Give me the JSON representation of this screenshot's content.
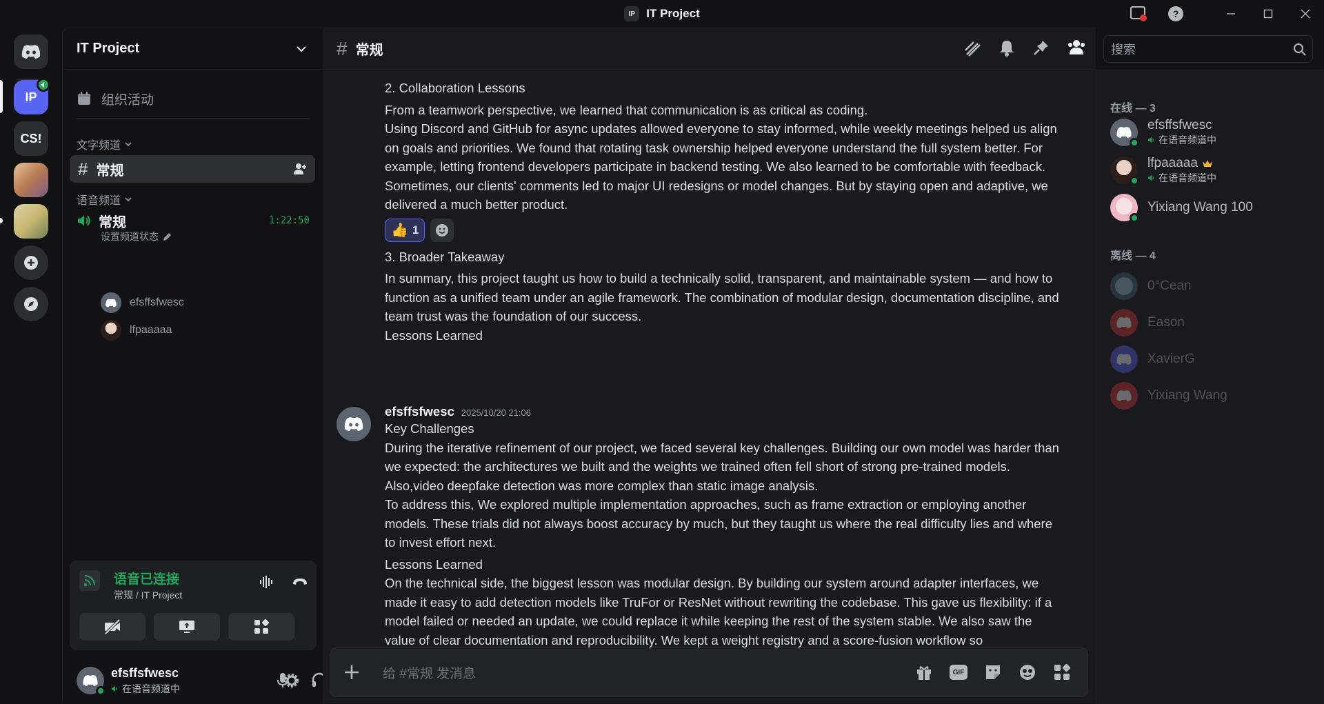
{
  "window": {
    "title": "IT Project",
    "badge": "IP"
  },
  "rail": {
    "servers": [
      {
        "label": "IP",
        "color": "#5865f2"
      },
      {
        "label": "CS!",
        "color": "#2b2d31"
      }
    ]
  },
  "sidebar": {
    "server_name": "IT Project",
    "events_label": "组织活动",
    "text_category": "文字频道",
    "text_channel": "常规",
    "voice_category": "语音频道",
    "voice_channel": "常规",
    "voice_timer": "1:22:50",
    "set_status": "设置频道状态",
    "voice_users": [
      "efsffsfwesc",
      "lfpaaaaa"
    ]
  },
  "voice_panel": {
    "status": "语音已连接",
    "location": "常规 / IT Project"
  },
  "user_panel": {
    "username": "efsffsfwesc",
    "status": "在语音频道中"
  },
  "chat": {
    "channel": "常规",
    "search_placeholder": "搜索",
    "composer_placeholder": "给 #常规 发消息",
    "gif_label": "GIF",
    "messages_top": {
      "heading1": "2. Collaboration Lessons",
      "p1": "From a teamwork perspective, we learned that communication is as critical as coding.",
      "p2": "Using Discord and GitHub for async updates allowed everyone to stay informed, while weekly meetings helped us align on goals and priorities. We found that rotating task ownership helped everyone understand the full system better. For example, letting frontend developers participate in backend testing. We also learned to be comfortable with feedback.",
      "p3": "Sometimes, our clients' comments led to major UI redesigns or model changes. But by staying open and adaptive, we delivered a much better product.",
      "reaction_count": "1",
      "heading2": "3. Broader Takeaway",
      "p4": "In summary, this project taught us how to build a technically solid, transparent, and maintainable system — and how to function as a unified team under an agile framework. The combination of modular design, documentation discipline, and team trust was the foundation of our success.",
      "p5": "Lessons Learned"
    },
    "message2": {
      "author": "efsffsfwesc",
      "timestamp": "2025/10/20 21:06",
      "heading": "Key Challenges",
      "p1": "During the iterative refinement of our project, we faced several key challenges. Building our own model was harder than we expected: the architectures we built and the weights we trained often fell short of strong pre-trained models. Also,video deepfake detection was more complex than static image analysis.",
      "p2": "To address this, We explored multiple implementation approaches, such as frame extraction or employing another models. These trials did not always boost accuracy by much, but they taught us where the real difficulty lies and where to invest effort next.",
      "heading2": "Lessons Learned",
      "p3": "On the technical side, the biggest lesson was modular design. By building our system around adapter interfaces, we made it easy to add detection models like TruFor or ResNet without rewriting the codebase. This gave us flexibility: if a model failed or needed an update, we could replace it while keeping the rest of the system stable. We also saw the value of clear documentation and reproducibility. We kept a weight registry and a score-fusion workflow so"
    }
  },
  "members": {
    "online_header": "在线 — 3",
    "offline_header": "离线 — 4",
    "online": [
      {
        "name": "efsffsfwesc",
        "sub": "在语音频道中"
      },
      {
        "name": "lfpaaaaa",
        "sub": "在语音频道中"
      },
      {
        "name": "Yixiang Wang 100",
        "sub": ""
      }
    ],
    "offline": [
      "0°Cean",
      "Eason",
      "XavierG",
      "Yixiang Wang"
    ]
  },
  "colors": {
    "accent": "#5865f2",
    "online": "#23a55a",
    "voice_green": "#23a55a",
    "danger": "#da373c"
  }
}
